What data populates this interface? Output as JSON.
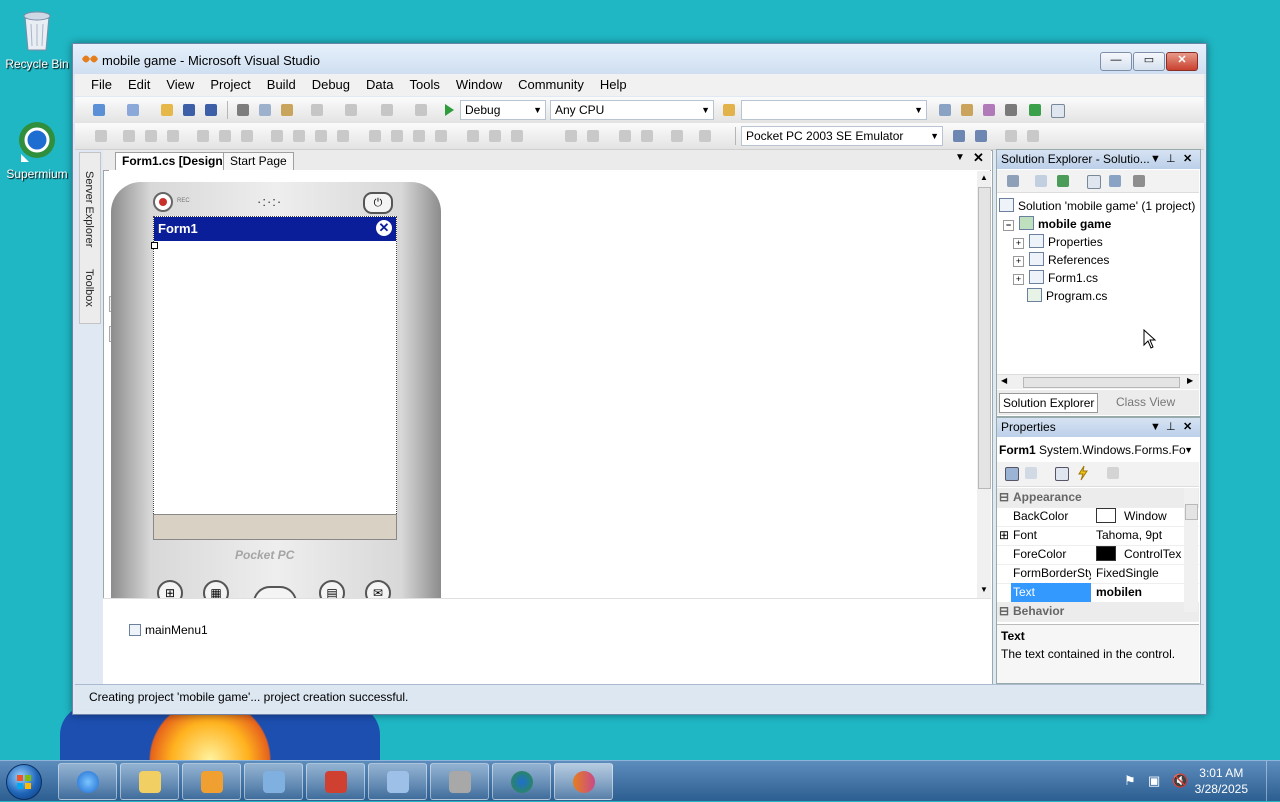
{
  "desktop": {
    "icons": [
      {
        "label": "Recycle Bin"
      },
      {
        "label": "Supermium"
      }
    ]
  },
  "window": {
    "title": "mobile game - Microsoft Visual Studio",
    "controls": {
      "minimize": "—",
      "maximize": "▭",
      "close": "✕"
    }
  },
  "menubar": [
    "File",
    "Edit",
    "View",
    "Project",
    "Build",
    "Debug",
    "Data",
    "Tools",
    "Window",
    "Community",
    "Help"
  ],
  "toolbar": {
    "config": "Debug",
    "platform": "Any CPU",
    "find_value": "",
    "device": "Pocket PC 2003 SE Emulator"
  },
  "left_dock": {
    "server_explorer": "Server Explorer",
    "toolbox": "Toolbox"
  },
  "document_tabs": [
    {
      "label": "Form1.cs [Design]",
      "active": true
    },
    {
      "label": "Start Page",
      "active": false
    }
  ],
  "designer": {
    "form_title": "Form1",
    "device_brand": "Pocket PC",
    "device_rec": "REC",
    "component_tray": [
      "mainMenu1"
    ]
  },
  "solution_explorer": {
    "title": "Solution Explorer - Solutio...",
    "solution": "Solution 'mobile game' (1 project)",
    "project": "mobile game",
    "items": [
      "Properties",
      "References",
      "Form1.cs",
      "Program.cs"
    ],
    "tabs": [
      "Solution Explorer",
      "Class View"
    ]
  },
  "properties": {
    "title": "Properties",
    "object": "Form1",
    "object_type": "System.Windows.Forms.Fo",
    "categories": [
      "Appearance",
      "Behavior"
    ],
    "rows": [
      {
        "name": "BackColor",
        "value": "Window",
        "swatch": "#ffffff"
      },
      {
        "name": "Font",
        "value": "Tahoma, 9pt"
      },
      {
        "name": "ForeColor",
        "value": "ControlTex",
        "swatch": "#000000"
      },
      {
        "name": "FormBorderSty",
        "value": "FixedSingle"
      },
      {
        "name": "Text",
        "value": "mobilen"
      }
    ],
    "description_title": "Text",
    "description": "The text contained in the control."
  },
  "statusbar": "Creating project 'mobile game'... project creation successful.",
  "taskbar": {
    "time": "3:01 AM",
    "date": "3/28/2025"
  },
  "colors": {
    "desktop": "#1fb7c4",
    "form_titlebar": "#0a1e9a",
    "selected_row": "#3399ff"
  }
}
